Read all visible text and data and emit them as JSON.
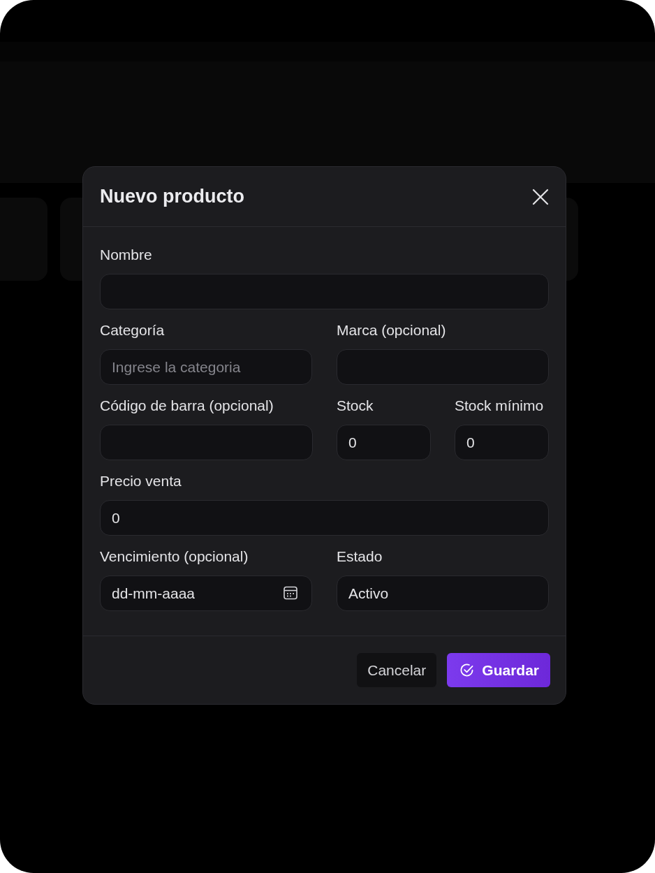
{
  "dialog": {
    "title": "Nuevo producto"
  },
  "rows": [
    [
      {
        "label": "Nombre",
        "kind": "text"
      }
    ],
    [
      {
        "label": "Categoría",
        "kind": "text",
        "placeholder": "Ingrese la categoria"
      },
      {
        "label": "Marca (opcional)",
        "kind": "text"
      }
    ],
    [
      {
        "label": "Código de barra (opcional)",
        "kind": "text"
      },
      {
        "label": "Stock",
        "kind": "number",
        "value": "0"
      },
      {
        "label": "Stock mínimo",
        "kind": "number",
        "value": "0"
      }
    ],
    [
      {
        "label": "Precio venta",
        "kind": "number",
        "value": "0"
      }
    ],
    [
      {
        "label": "Vencimiento (opcional)",
        "kind": "date",
        "placeholder": "dd-mm-aaaa"
      },
      {
        "label": "Estado",
        "kind": "select",
        "value": "Activo"
      }
    ]
  ],
  "buttons": [
    {
      "label": "Cancelar",
      "kind": "secondary"
    },
    {
      "label": "Guardar",
      "kind": "primary"
    }
  ]
}
